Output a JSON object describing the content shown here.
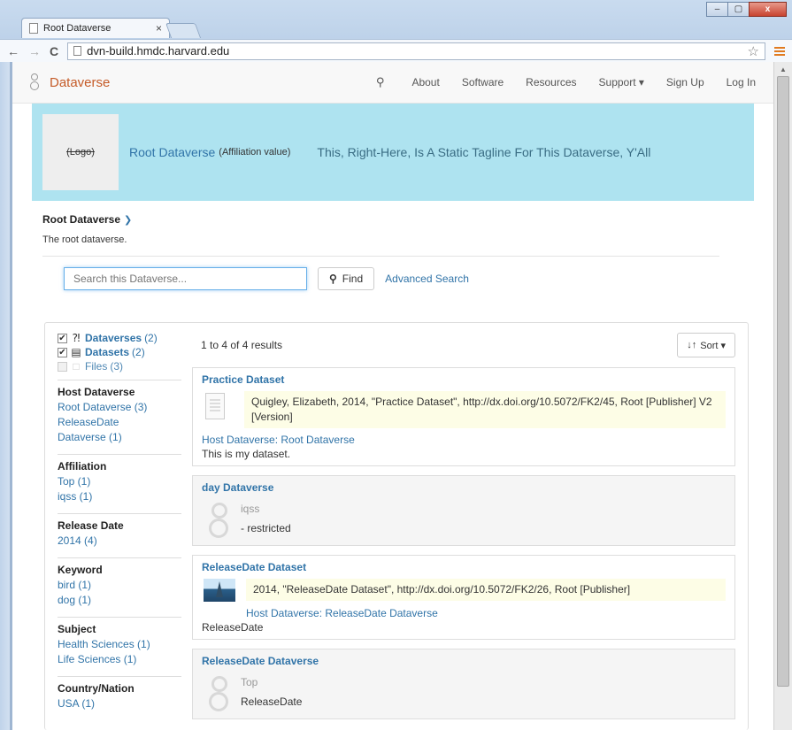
{
  "browser": {
    "tab_title": "Root Dataverse",
    "tab_close": "×",
    "url": "dvn-build.hmdc.harvard.edu",
    "win_min": "–",
    "win_max": "▢",
    "win_close": "x"
  },
  "navbar": {
    "brand": "Dataverse",
    "items": [
      "About",
      "Software",
      "Resources",
      "Support ▾",
      "Sign Up",
      "Log In"
    ]
  },
  "banner": {
    "logo_text": "(Logo)",
    "name": "Root Dataverse",
    "affiliation": "(Affiliation value)",
    "tagline": "This, Right-Here, Is A Static Tagline For This Dataverse, Y'All"
  },
  "breadcrumb": {
    "title": "Root Dataverse",
    "description": "The root dataverse."
  },
  "search": {
    "placeholder": "Search this Dataverse...",
    "find_label": "Find",
    "advanced_label": "Advanced Search"
  },
  "type_facets": [
    {
      "label": "Dataverses",
      "count": "(2)",
      "checked": true
    },
    {
      "label": "Datasets",
      "count": "(2)",
      "checked": true
    },
    {
      "label": "Files",
      "count": "(3)",
      "checked": false
    }
  ],
  "facets": [
    {
      "title": "Host Dataverse",
      "items": [
        "Root Dataverse (3)",
        "ReleaseDate Dataverse (1)"
      ]
    },
    {
      "title": "Affiliation",
      "items": [
        "Top (1)",
        "iqss (1)"
      ]
    },
    {
      "title": "Release Date",
      "items": [
        "2014 (4)"
      ]
    },
    {
      "title": "Keyword",
      "items": [
        "bird (1)",
        "dog (1)"
      ]
    },
    {
      "title": "Subject",
      "items": [
        "Health Sciences (1)",
        "Life Sciences (1)"
      ]
    },
    {
      "title": "Country/Nation",
      "items": [
        "USA (1)"
      ]
    }
  ],
  "results": {
    "count_text": "1 to 4 of 4 results",
    "sort_label": "Sort ▾",
    "cards": [
      {
        "type": "dataset",
        "title": "Practice Dataset",
        "citation": "Quigley, Elizabeth, 2014, \"Practice Dataset\", http://dx.doi.org/10.5072/FK2/45, Root [Publisher] V2 [Version]",
        "host": "Host Dataverse: Root Dataverse",
        "description": "This is my dataset."
      },
      {
        "type": "dataverse",
        "title": "day Dataverse",
        "line1": "iqss",
        "line2": "- restricted"
      },
      {
        "type": "dataset-image",
        "title": "ReleaseDate Dataset",
        "citation": "2014, \"ReleaseDate Dataset\", http://dx.doi.org/10.5072/FK2/26, Root [Publisher]",
        "host": "Host Dataverse: ReleaseDate Dataverse",
        "description": "ReleaseDate"
      },
      {
        "type": "dataverse",
        "title": "ReleaseDate Dataverse",
        "line1": "Top",
        "line2": "ReleaseDate"
      }
    ]
  },
  "colors": {
    "link": "#3174a8",
    "brand": "#c55b28",
    "banner": "#aee3f0",
    "citation_bg": "#fdfde6"
  }
}
